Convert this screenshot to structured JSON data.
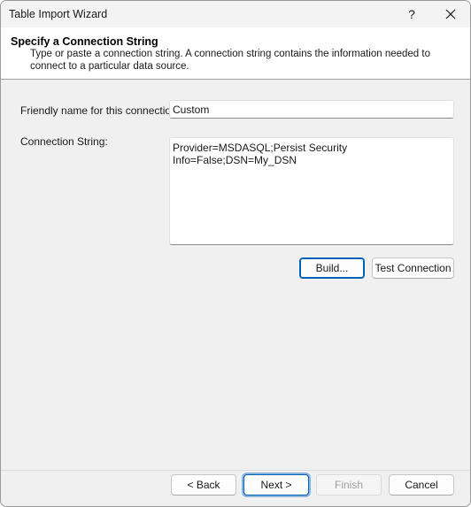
{
  "window": {
    "title": "Table Import Wizard",
    "help_glyph": "?"
  },
  "header": {
    "title": "Specify a Connection String",
    "description": "Type or paste a connection string. A connection string contains the information needed to connect to a particular data source."
  },
  "form": {
    "friendly_name_label": "Friendly name for this connection:",
    "friendly_name_value": "Custom",
    "connection_string_label": "Connection String:",
    "connection_string_value": "Provider=MSDASQL;Persist Security Info=False;DSN=My_DSN"
  },
  "actions": {
    "build_label": "Build...",
    "test_connection_label": "Test Connection"
  },
  "footer": {
    "back_label": "< Back",
    "next_label": "Next >",
    "finish_label": "Finish",
    "cancel_label": "Cancel"
  },
  "icons": {
    "help": "question-mark-icon",
    "close": "close-icon"
  },
  "colors": {
    "accent": "#005fb8",
    "dialog_background": "#f0f0f0"
  }
}
